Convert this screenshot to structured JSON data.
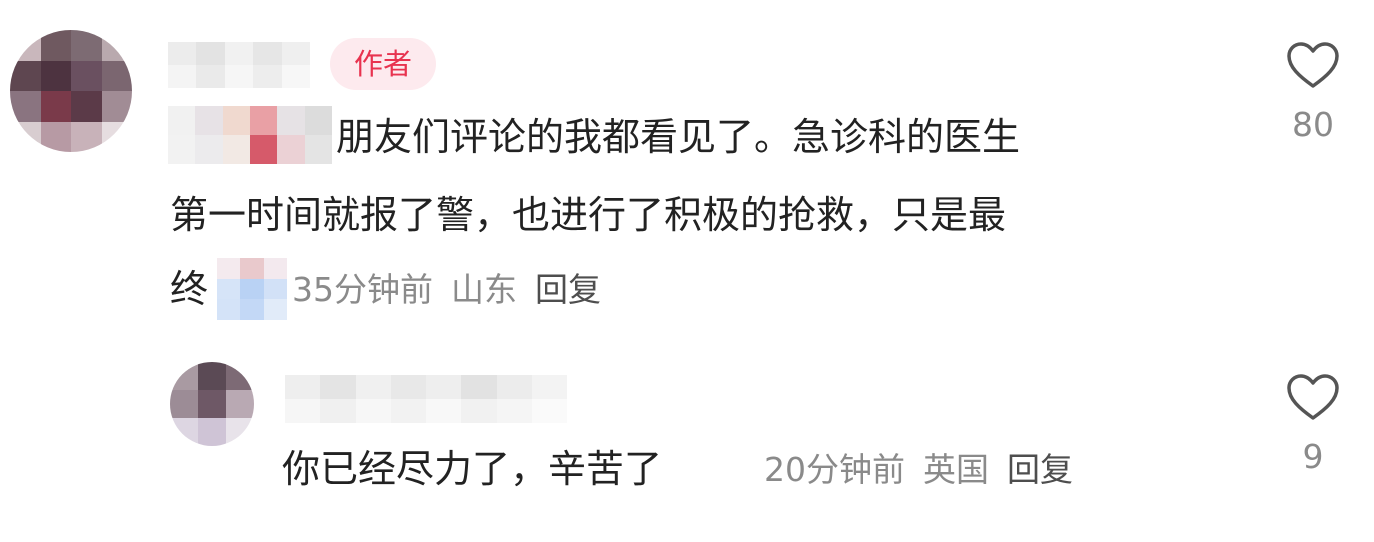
{
  "author_badge": "作者",
  "comment": {
    "line1": "朋友们评论的我都看见了。急诊科的医生",
    "line2": "第一时间就报了警，也进行了积极的抢救，只是最",
    "line3_start": "终",
    "time": "35分钟前",
    "location": "山东",
    "reply_label": "回复",
    "like_icon": "heart-outline-icon",
    "like_count": "80"
  },
  "reply": {
    "text": "你已经尽力了，辛苦了",
    "time": "20分钟前",
    "location": "英国",
    "reply_label": "回复",
    "like_icon": "heart-outline-icon",
    "like_count": "9"
  },
  "colors": {
    "badge_text": "#e8334f",
    "badge_bg": "#fdeaee",
    "text": "#222222",
    "meta": "#8a8a8a"
  }
}
